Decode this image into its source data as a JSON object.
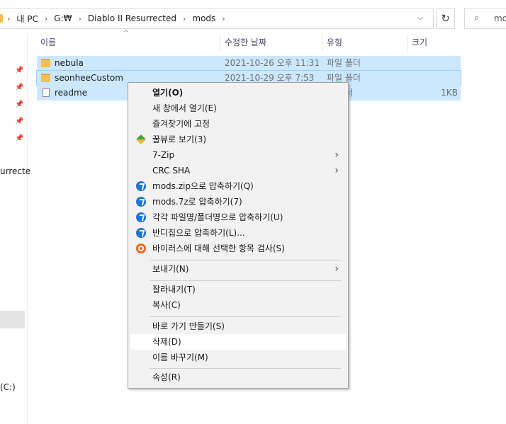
{
  "address": {
    "crumbs": [
      "내 PC",
      "G:₩",
      "Diablo II Resurrected",
      "mods"
    ],
    "dropdown_icon": "chevron-down-icon",
    "refresh_icon": "refresh-icon",
    "search_placeholder": "mo"
  },
  "nav": {
    "truncated_item": "urrecte",
    "drive_label": "(C:)"
  },
  "columns": {
    "name": "이름",
    "date": "수정한 날짜",
    "type": "유형",
    "size": "크기"
  },
  "files": [
    {
      "name": "nebula",
      "date": "2021-10-26 오후 11:31",
      "type": "파일 폴더",
      "size": ""
    },
    {
      "name": "seonheeCustom",
      "date": "2021-10-29 오후 7:53",
      "type": "파일 폴더",
      "size": ""
    },
    {
      "name": "readme",
      "date": "",
      "type": "트 문서",
      "size": "1KB"
    }
  ],
  "context_menu": {
    "open": "열기(O)",
    "open_new_window": "새 창에서 열기(E)",
    "pin_quick_access": "즐겨찾기에 고정",
    "honeyview": "꿀뷰로 보기(3)",
    "sevenzip": "7-Zip",
    "crc_sha": "CRC SHA",
    "zip_mods": "mods.zip으로 압축하기(Q)",
    "sevenz_mods": "mods.7z로 압축하기(7)",
    "zip_each": "각각 파일명/폴더명으로 압축하기(U)",
    "bandizip": "반디집으로 압축하기(L)...",
    "virus_scan": "바이러스에 대해 선택한 항목 검사(S)",
    "send_to": "보내기(N)",
    "cut": "잘라내기(T)",
    "copy": "복사(C)",
    "create_shortcut": "바로 가기 만들기(S)",
    "delete": "삭제(D)",
    "rename": "이름 바꾸기(M)",
    "properties": "속성(R)"
  }
}
